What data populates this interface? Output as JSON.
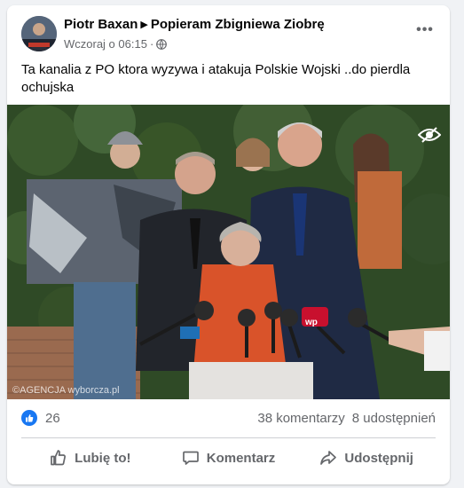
{
  "post": {
    "author": "Piotr Baxan",
    "group": "Popieram Zbigniewa Ziobrę",
    "timestamp": "Wczoraj o 06:15",
    "separator": "·",
    "text": "Ta kanalia z PO ktora wyzywa i atakuja Polskie Wojski ..do pierdla ochujska",
    "more_label": "•••"
  },
  "photo": {
    "watermark": "©AGENCJA wyborcza.pl",
    "mic_label": "wp"
  },
  "stats": {
    "reactions": "26",
    "comments": "38 komentarzy",
    "shares": "8 udostępnień"
  },
  "actions": {
    "like": "Lubię to!",
    "comment": "Komentarz",
    "share": "Udostępnij"
  },
  "colors": {
    "accent": "#1877f2",
    "secondary_text": "#65676b",
    "background": "#f0f2f5"
  }
}
